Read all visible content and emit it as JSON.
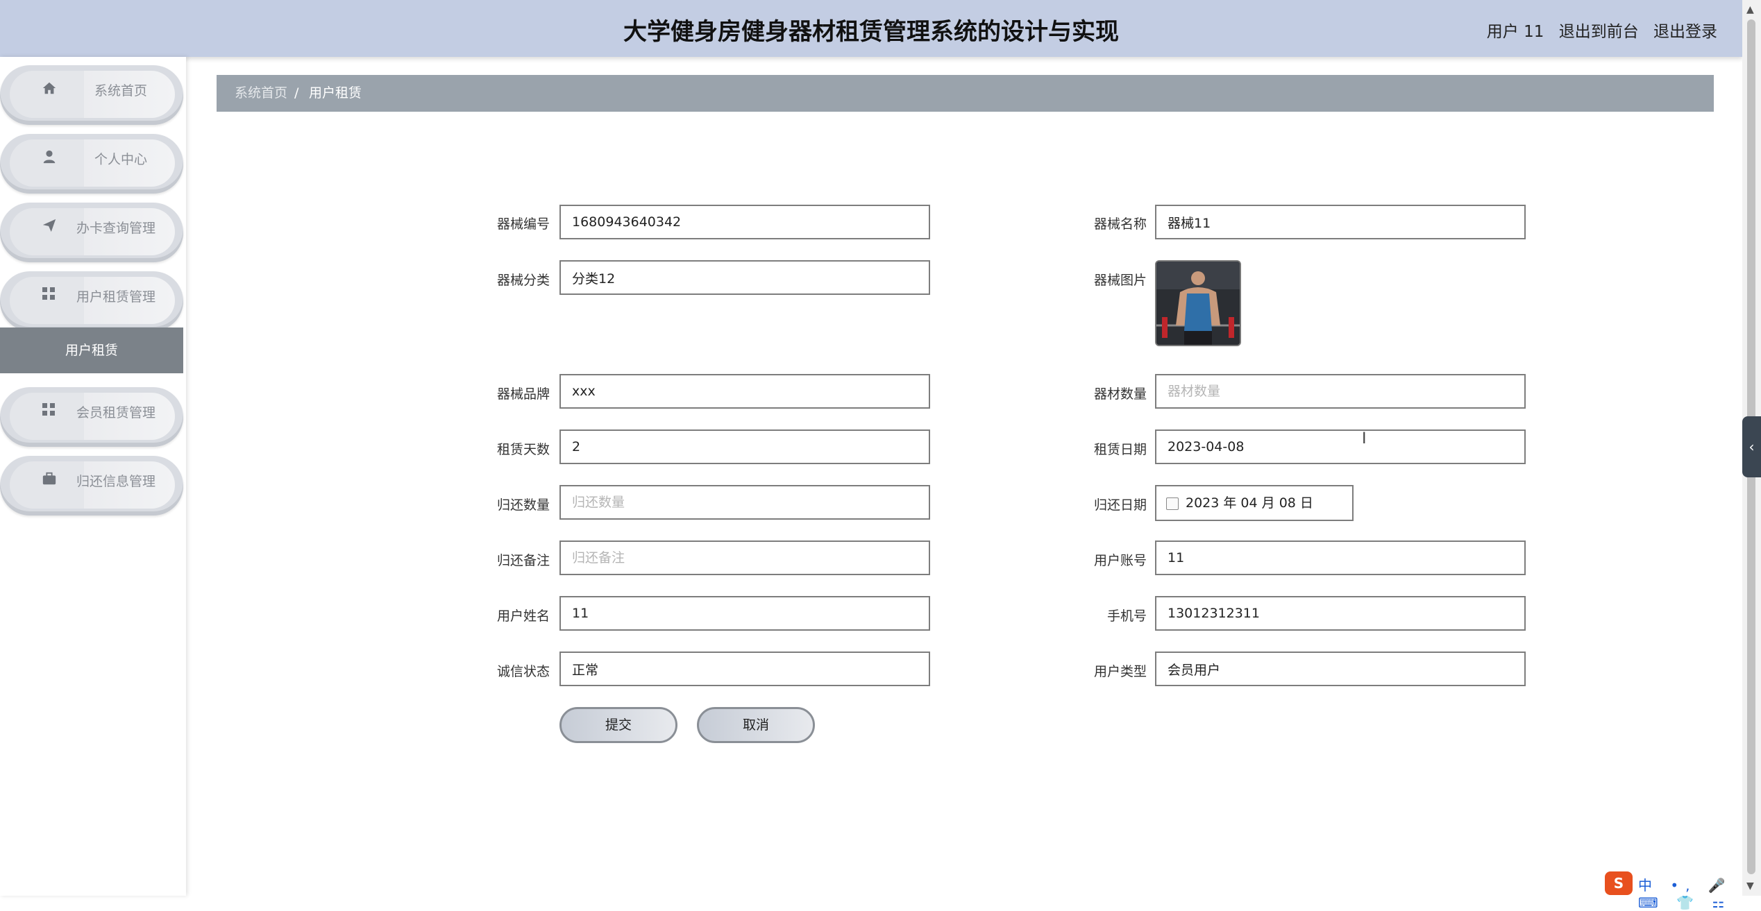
{
  "header": {
    "title": "大学健身房健身器材租赁管理系统的设计与实现",
    "user_label": "用户 11",
    "front_link": "退出到前台",
    "logout_link": "退出登录"
  },
  "sidebar": {
    "items": [
      {
        "label": "系统首页",
        "icon": "home-icon"
      },
      {
        "label": "个人中心",
        "icon": "user-icon"
      },
      {
        "label": "办卡查询管理",
        "icon": "paper-plane-icon"
      },
      {
        "label": "用户租赁管理",
        "icon": "grid-icon"
      },
      {
        "label": "会员租赁管理",
        "icon": "grid-icon"
      },
      {
        "label": "归还信息管理",
        "icon": "briefcase-icon"
      }
    ],
    "submenu": "用户租赁"
  },
  "breadcrumb": {
    "home": "系统首页",
    "separator": "/",
    "current": "用户租赁"
  },
  "form": {
    "equipment_no": {
      "label": "器械编号",
      "value": "1680943640342"
    },
    "equipment_name": {
      "label": "器械名称",
      "value": "器械11"
    },
    "category": {
      "label": "器械分类",
      "value": "分类12"
    },
    "image": {
      "label": "器械图片"
    },
    "brand": {
      "label": "器械品牌",
      "value": "xxx"
    },
    "quantity": {
      "label": "器材数量",
      "value": "",
      "placeholder": "器材数量"
    },
    "rent_days": {
      "label": "租赁天数",
      "value": "2"
    },
    "rent_date": {
      "label": "租赁日期",
      "value": "2023-04-08"
    },
    "return_qty": {
      "label": "归还数量",
      "value": "",
      "placeholder": "归还数量"
    },
    "return_date": {
      "label": "归还日期",
      "value": "2023 年 04 月 08 日"
    },
    "return_note": {
      "label": "归还备注",
      "value": "",
      "placeholder": "归还备注"
    },
    "account": {
      "label": "用户账号",
      "value": "11"
    },
    "user_name": {
      "label": "用户姓名",
      "value": "11"
    },
    "phone": {
      "label": "手机号",
      "value": "13012312311"
    },
    "credit": {
      "label": "诚信状态",
      "value": "正常"
    },
    "user_type": {
      "label": "用户类型",
      "value": "会员用户"
    }
  },
  "buttons": {
    "submit": "提交",
    "cancel": "取消"
  },
  "tray": {
    "logo": "S",
    "items": "中 •, 🎤 ⌨ 👕 ⚏"
  }
}
